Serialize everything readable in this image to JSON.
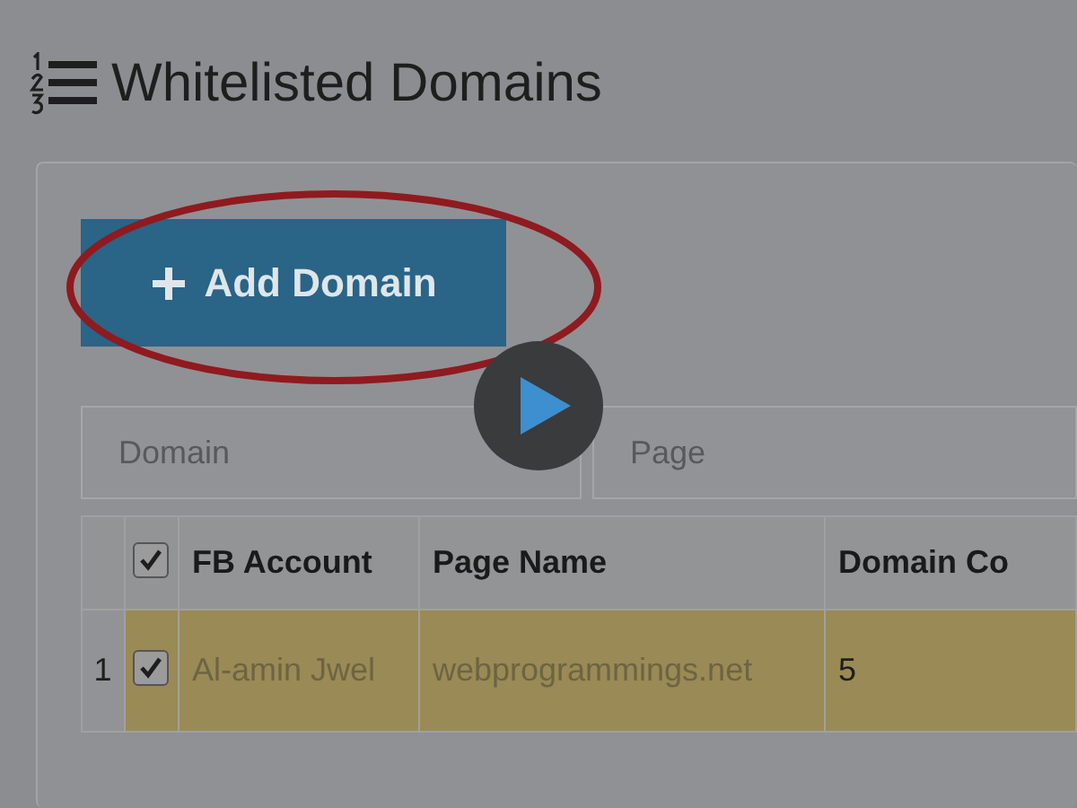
{
  "page": {
    "title": "Whitelisted Domains"
  },
  "add_button": {
    "label": "Add Domain"
  },
  "filters": [
    {
      "placeholder": "Domain"
    },
    {
      "placeholder": "Page"
    }
  ],
  "table": {
    "select_all_checked": true,
    "columns": [
      "FB Account",
      "Page Name",
      "Domain Co"
    ],
    "rows": [
      {
        "number": "1",
        "checked": true,
        "selected": true,
        "cells": [
          "Al-amin Jwel",
          "webprogrammings.net",
          "5"
        ]
      }
    ]
  }
}
